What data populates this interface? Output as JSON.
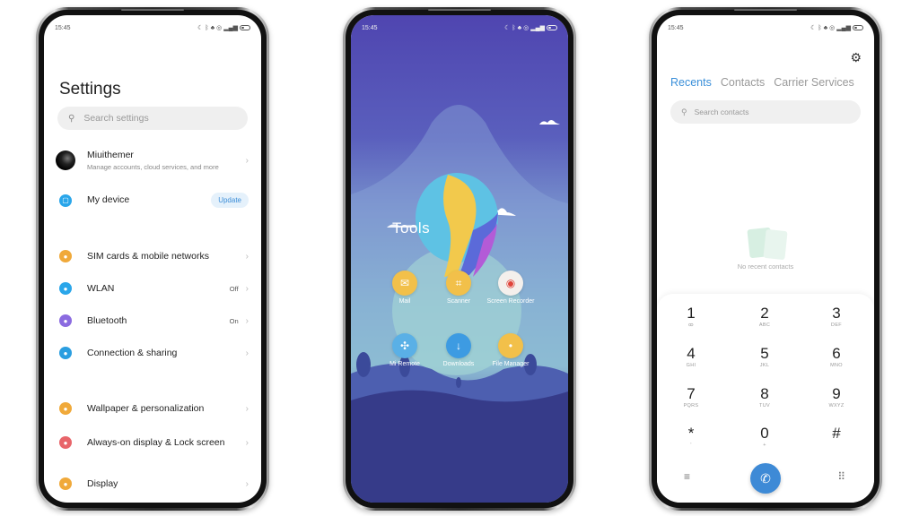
{
  "status": {
    "time": "15:45",
    "icons": [
      "moon-icon",
      "bluetooth-icon",
      "notification-icon",
      "alarm-icon",
      "signal-icon",
      "battery-icon"
    ]
  },
  "settings": {
    "title": "Settings",
    "search_placeholder": "Search settings",
    "account": {
      "name": "Miuithemer",
      "subtitle": "Manage accounts, cloud services, and more"
    },
    "my_device": {
      "label": "My device",
      "badge": "Update"
    },
    "items": [
      {
        "label": "SIM cards & mobile networks",
        "value": "",
        "color": "#f0a93a",
        "icon": "sim-card-icon"
      },
      {
        "label": "WLAN",
        "value": "Off",
        "color": "#2aa6ea",
        "icon": "wifi-icon"
      },
      {
        "label": "Bluetooth",
        "value": "On",
        "color": "#8b6be0",
        "icon": "bluetooth-icon"
      },
      {
        "label": "Connection & sharing",
        "value": "",
        "color": "#2a9ee0",
        "icon": "connection-icon"
      },
      {
        "label": "Wallpaper & personalization",
        "value": "",
        "color": "#f0a93a",
        "icon": "shirt-icon"
      },
      {
        "label": "Always-on display & Lock screen",
        "value": "",
        "color": "#e8656a",
        "icon": "lock-icon"
      },
      {
        "label": "Display",
        "value": "",
        "color": "#f0a93a",
        "icon": "sun-icon"
      }
    ]
  },
  "tools": {
    "title": "Tools",
    "apps": [
      {
        "label": "Mail",
        "color": "#f2c04a",
        "glyph": "✉"
      },
      {
        "label": "Scanner",
        "color": "#f2c04a",
        "glyph": "⌗"
      },
      {
        "label": "Screen Recorder",
        "color": "#f4f0ec",
        "glyph": "◉"
      },
      {
        "label": "Mi Remote",
        "color": "#5ab0e6",
        "glyph": "✣"
      },
      {
        "label": "Downloads",
        "color": "#3d9be2",
        "glyph": "↓"
      },
      {
        "label": "File Manager",
        "color": "#f2c04a",
        "glyph": "•"
      }
    ]
  },
  "dialer": {
    "tabs": [
      "Recents",
      "Contacts",
      "Carrier Services"
    ],
    "active_tab": "Recents",
    "search_placeholder": "Search contacts",
    "empty_text": "No recent contacts",
    "keys": [
      {
        "n": "1",
        "l": "ꝏ"
      },
      {
        "n": "2",
        "l": "ABC"
      },
      {
        "n": "3",
        "l": "DEF"
      },
      {
        "n": "4",
        "l": "GHI"
      },
      {
        "n": "5",
        "l": "JKL"
      },
      {
        "n": "6",
        "l": "MNO"
      },
      {
        "n": "7",
        "l": "PQRS"
      },
      {
        "n": "8",
        "l": "TUV"
      },
      {
        "n": "9",
        "l": "WXYZ"
      },
      {
        "n": "*",
        "l": "'"
      },
      {
        "n": "0",
        "l": "+"
      },
      {
        "n": "#",
        "l": ""
      }
    ]
  }
}
